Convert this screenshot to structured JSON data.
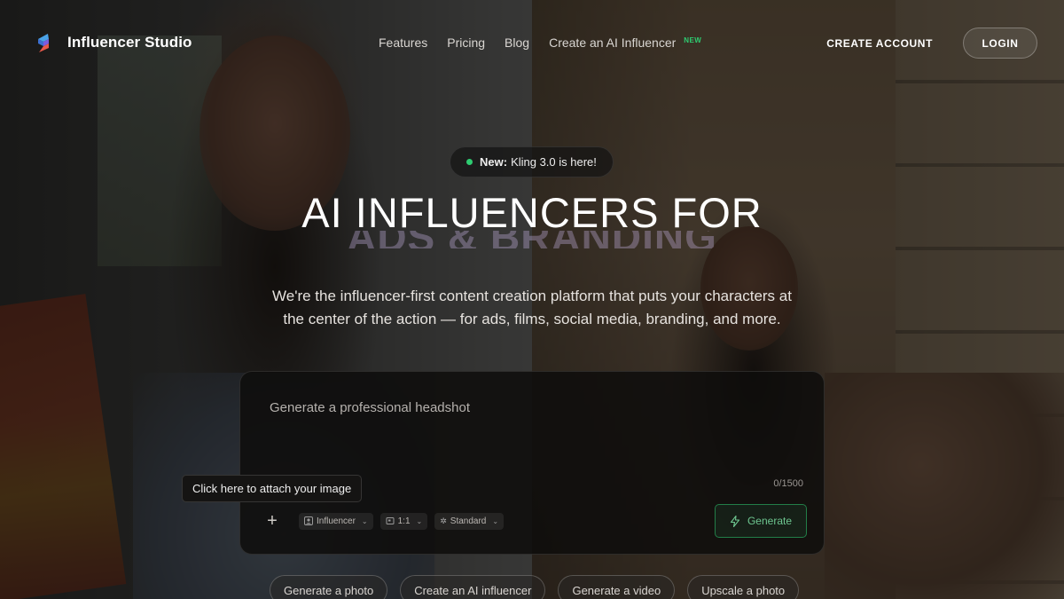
{
  "brand": {
    "name": "Influencer Studio",
    "logo_icon": "stacked-s-logo-icon"
  },
  "nav": {
    "links": [
      {
        "label": "Features"
      },
      {
        "label": "Pricing"
      },
      {
        "label": "Blog"
      },
      {
        "label": "Create an AI Influencer",
        "badge": "NEW"
      }
    ],
    "create_account": "CREATE ACCOUNT",
    "login": "LOGIN"
  },
  "announcement": {
    "strong": "New:",
    "text": "Kling 3.0 is here!"
  },
  "hero": {
    "title": "AI INFLUENCERS FOR",
    "rotating_word": "ADS & BRANDING",
    "subtitle": "We're the influencer-first content creation platform that puts your characters at the center of the action — for ads, films, social media, branding, and more."
  },
  "prompt": {
    "placeholder": "Generate a professional headshot",
    "char_count": "0/1500",
    "tooltip": "Click here to attach your image",
    "chips": [
      {
        "label": "Influencer",
        "icon": "person-icon"
      },
      {
        "label": "1:1",
        "icon": "aspect-ratio-icon"
      },
      {
        "label": "Standard",
        "icon": "sparkle-icon"
      }
    ],
    "generate": "Generate"
  },
  "suggestions": [
    "Generate a photo",
    "Create an AI influencer",
    "Generate a video",
    "Upscale a photo"
  ],
  "colors": {
    "accent_green": "#2ecc71",
    "background": "#1a1714"
  }
}
